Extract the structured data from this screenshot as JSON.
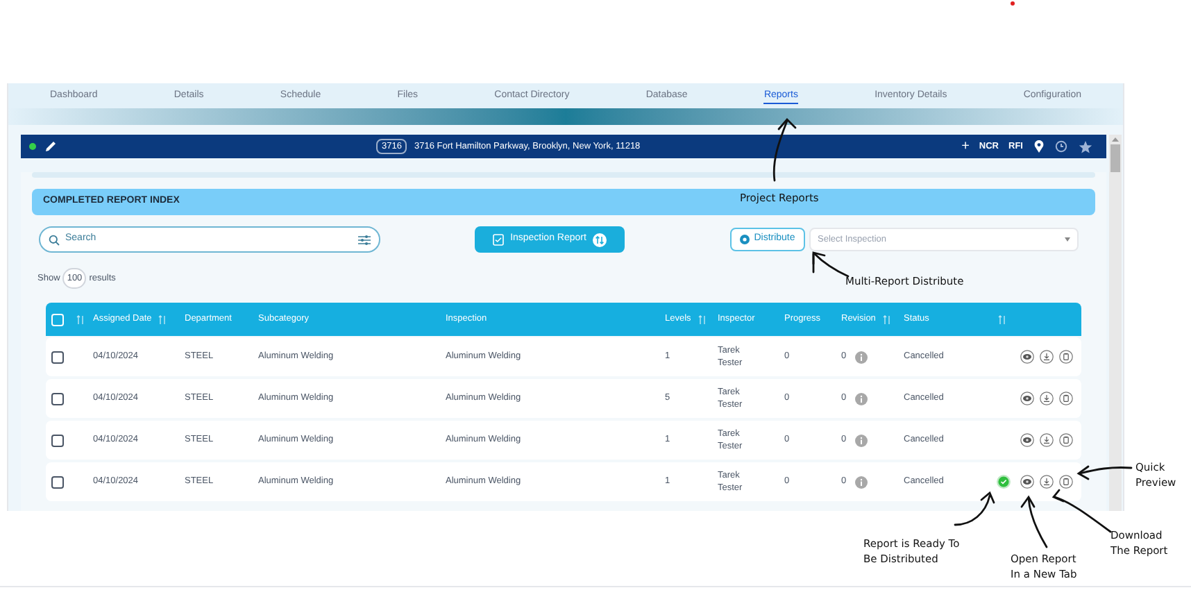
{
  "nav_tabs": [
    {
      "label": "Dashboard",
      "selected": false
    },
    {
      "label": "Details",
      "selected": false
    },
    {
      "label": "Schedule",
      "selected": false
    },
    {
      "label": "Files",
      "selected": false
    },
    {
      "label": "Contact Directory",
      "selected": false
    },
    {
      "label": "Database",
      "selected": false
    },
    {
      "label": "Reports",
      "selected": true
    },
    {
      "label": "Inventory Details",
      "selected": false
    },
    {
      "label": "Configuration",
      "selected": false
    }
  ],
  "project_bar": {
    "code": "3716",
    "address": "3716 Fort Hamilton Parkway, Brooklyn, New York, 11218",
    "actions": [
      "+",
      "NCR",
      "RFI"
    ]
  },
  "section_title": "COMPLETED REPORT INDEX",
  "search": {
    "placeholder": "Search"
  },
  "inspection_report_button": "Inspection Report",
  "distribute_button": "Distribute",
  "inspection_select": {
    "placeholder": "Select Inspection"
  },
  "results": {
    "prefix": "Show",
    "count": "100",
    "suffix": "results"
  },
  "table": {
    "columns": [
      {
        "kind": "checkbox",
        "checked": false,
        "sortable": true
      },
      {
        "kind": "text",
        "label": "Assigned Date",
        "sortable": true
      },
      {
        "kind": "text",
        "label": "Department",
        "sortable": false
      },
      {
        "kind": "text",
        "label": "Subcategory",
        "sortable": false
      },
      {
        "kind": "text",
        "label": "Inspection",
        "sortable": false
      },
      {
        "kind": "text",
        "label": "Levels",
        "sortable": true
      },
      {
        "kind": "text",
        "label": "Inspector",
        "sortable": false
      },
      {
        "kind": "text",
        "label": "Progress",
        "sortable": false
      },
      {
        "kind": "text",
        "label": "Revision",
        "sortable": true
      },
      {
        "kind": "text",
        "label": "Status",
        "sortable": false
      },
      {
        "kind": "actions",
        "sortable": true
      }
    ],
    "rows": [
      {
        "checked": false,
        "assigned_date": "04/10/2024",
        "department": "STEEL",
        "subcategory": "Aluminum Welding",
        "inspection": "Aluminum Welding",
        "levels": "1",
        "inspector": "Tarek Tester",
        "progress": "0",
        "revision": "0",
        "status": "Cancelled",
        "ready": false
      },
      {
        "checked": false,
        "assigned_date": "04/10/2024",
        "department": "STEEL",
        "subcategory": "Aluminum Welding",
        "inspection": "Aluminum Welding",
        "levels": "5",
        "inspector": "Tarek Tester",
        "progress": "0",
        "revision": "0",
        "status": "Cancelled",
        "ready": false
      },
      {
        "checked": false,
        "assigned_date": "04/10/2024",
        "department": "STEEL",
        "subcategory": "Aluminum Welding",
        "inspection": "Aluminum Welding",
        "levels": "1",
        "inspector": "Tarek Tester",
        "progress": "0",
        "revision": "0",
        "status": "Cancelled",
        "ready": false
      },
      {
        "checked": false,
        "assigned_date": "04/10/2024",
        "department": "STEEL",
        "subcategory": "Aluminum Welding",
        "inspection": "Aluminum Welding",
        "levels": "1",
        "inspector": "Tarek Tester",
        "progress": "0",
        "revision": "0",
        "status": "Cancelled",
        "ready": true
      }
    ]
  },
  "annotations": [
    "Project Reports",
    "Multi-Report Distribute",
    "Quick Preview",
    "Report is Ready To Be Distributed",
    "Open Report In a New Tab",
    "Download The Report"
  ]
}
